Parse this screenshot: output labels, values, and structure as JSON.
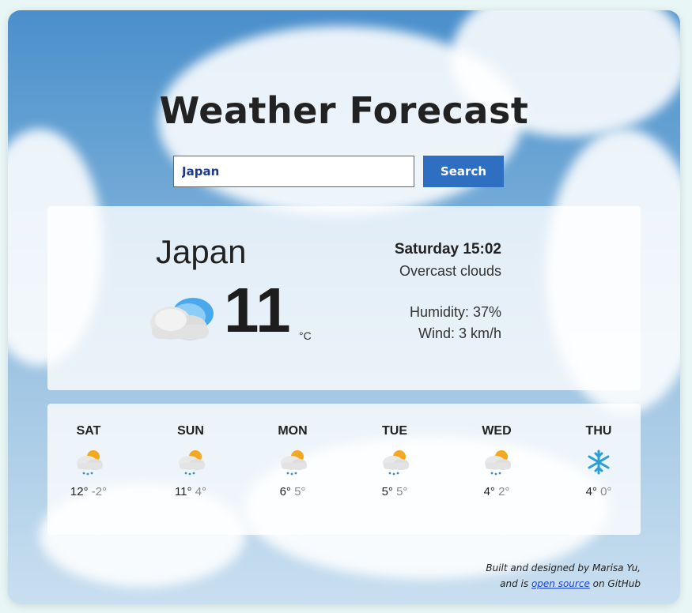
{
  "app": {
    "title": "Weather Forecast",
    "search": {
      "value": "Japan",
      "button_label": "Search"
    }
  },
  "current": {
    "city": "Japan",
    "temperature": "11",
    "unit": "°C",
    "datetime": "Saturday 15:02",
    "description": "Overcast clouds",
    "humidity": "Humidity: 37%",
    "wind": "Wind: 3 km/h",
    "icon": "overcast-clouds-icon"
  },
  "forecast": [
    {
      "day": "SAT",
      "max": "12°",
      "min": "-2°",
      "icon": "rain-sun-cloud-icon"
    },
    {
      "day": "SUN",
      "max": "11°",
      "min": "4°",
      "icon": "rain-sun-cloud-icon"
    },
    {
      "day": "MON",
      "max": "6°",
      "min": "5°",
      "icon": "rain-sun-cloud-icon"
    },
    {
      "day": "TUE",
      "max": "5°",
      "min": "5°",
      "icon": "rain-sun-cloud-icon"
    },
    {
      "day": "WED",
      "max": "4°",
      "min": "2°",
      "icon": "rain-sun-cloud-icon"
    },
    {
      "day": "THU",
      "max": "4°",
      "min": "0°",
      "icon": "snowflake-icon"
    }
  ],
  "footer": {
    "line1": "Built and designed by Marisa Yu,",
    "line2_prefix": "and is ",
    "link_text": "open source",
    "line2_suffix": " on GitHub"
  },
  "colors": {
    "accent": "#2f6fc1",
    "link": "#1a43d8",
    "sky": "#4a8fcb"
  }
}
